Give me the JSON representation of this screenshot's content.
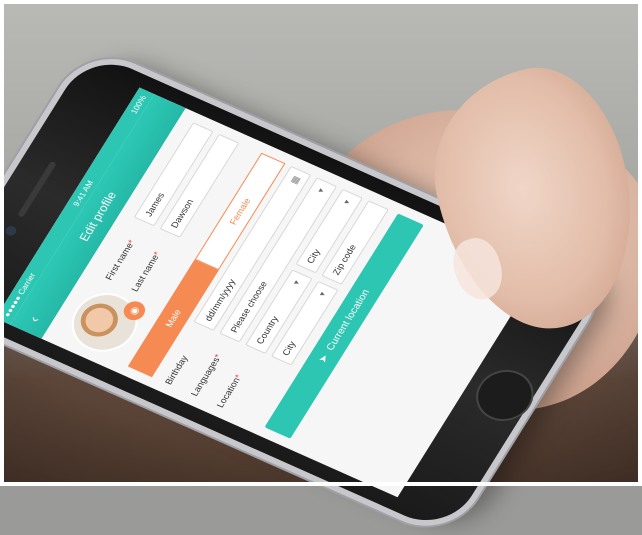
{
  "status": {
    "carrier": "●●●●● Carrier",
    "time": "9:41 AM",
    "battery": "100%"
  },
  "nav": {
    "title": "Edit profile",
    "back_icon": "back-arrow-icon"
  },
  "profile": {
    "first_name_label": "First name",
    "first_name_value": "James",
    "last_name_label": "Last name",
    "last_name_value": "Dawson",
    "required_mark": "*"
  },
  "gender": {
    "male": "Male",
    "female": "Female",
    "selected": "Male",
    "accent": "#f58a52"
  },
  "birthday": {
    "label": "Birthday",
    "placeholder": "dd/mm/yyyy"
  },
  "languages": {
    "label": "Languages",
    "placeholder": "Please choose"
  },
  "location": {
    "label": "Location",
    "country": "Country",
    "city_top": "City",
    "city": "City",
    "zip": "Zip code",
    "current_location_btn": "Current location"
  },
  "colors": {
    "primary": "#2cc6b3",
    "accent": "#f58a52"
  }
}
